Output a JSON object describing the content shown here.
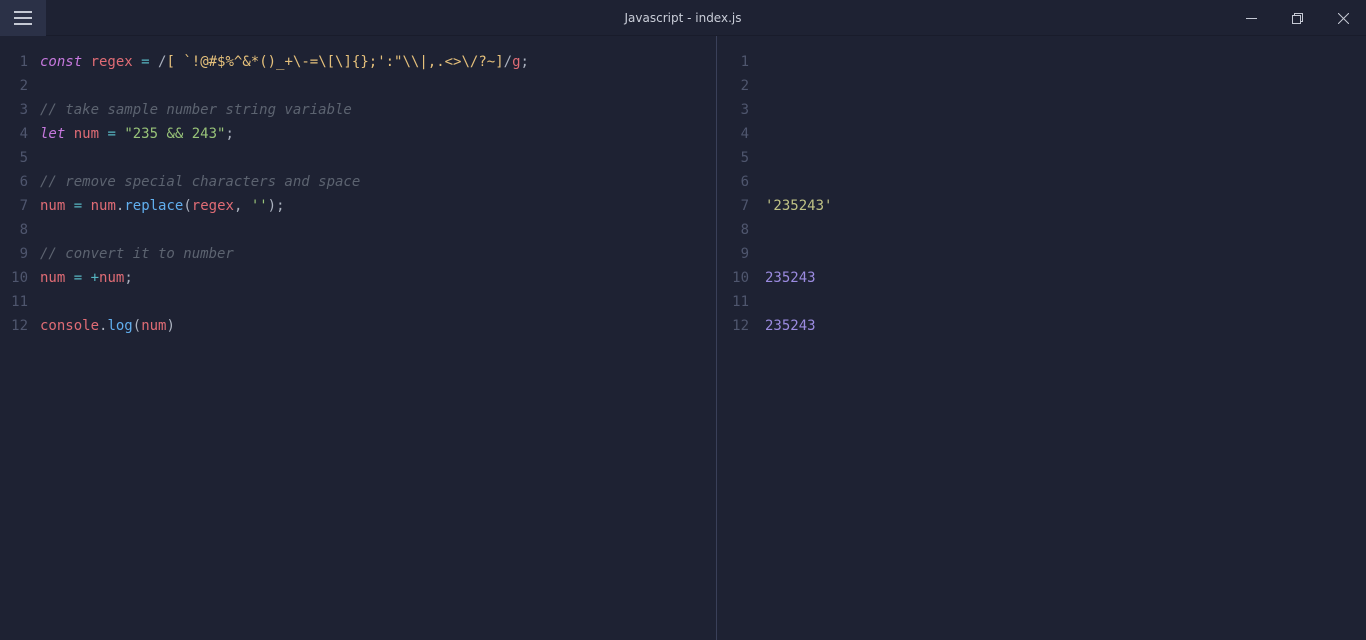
{
  "titlebar": {
    "title": "Javascript - index.js"
  },
  "editor": {
    "left": {
      "lines": [
        {
          "n": "1",
          "tokens": [
            {
              "t": "const ",
              "c": "kw"
            },
            {
              "t": "regex",
              "c": "ident"
            },
            {
              "t": " ",
              "c": "plain"
            },
            {
              "t": "=",
              "c": "op"
            },
            {
              "t": " ",
              "c": "plain"
            },
            {
              "t": "/",
              "c": "regex-delim"
            },
            {
              "t": "[ `!@#$%^&*()_+\\-=\\[\\]{};':\"\\\\|,.<>\\/?~]",
              "c": "regex-body"
            },
            {
              "t": "/",
              "c": "regex-delim"
            },
            {
              "t": "g",
              "c": "ident"
            },
            {
              "t": ";",
              "c": "plain"
            }
          ]
        },
        {
          "n": "2",
          "tokens": []
        },
        {
          "n": "3",
          "tokens": [
            {
              "t": "// take sample number string variable",
              "c": "comment"
            }
          ]
        },
        {
          "n": "4",
          "tokens": [
            {
              "t": "let ",
              "c": "kw"
            },
            {
              "t": "num",
              "c": "ident"
            },
            {
              "t": " ",
              "c": "plain"
            },
            {
              "t": "=",
              "c": "op"
            },
            {
              "t": " ",
              "c": "plain"
            },
            {
              "t": "\"235 && 243\"",
              "c": "str"
            },
            {
              "t": ";",
              "c": "plain"
            }
          ]
        },
        {
          "n": "5",
          "tokens": []
        },
        {
          "n": "6",
          "tokens": [
            {
              "t": "// remove special characters and space",
              "c": "comment"
            }
          ]
        },
        {
          "n": "7",
          "tokens": [
            {
              "t": "num",
              "c": "ident"
            },
            {
              "t": " ",
              "c": "plain"
            },
            {
              "t": "=",
              "c": "op"
            },
            {
              "t": " ",
              "c": "plain"
            },
            {
              "t": "num",
              "c": "ident"
            },
            {
              "t": ".",
              "c": "plain"
            },
            {
              "t": "replace",
              "c": "method"
            },
            {
              "t": "(",
              "c": "plain"
            },
            {
              "t": "regex",
              "c": "ident"
            },
            {
              "t": ", ",
              "c": "plain"
            },
            {
              "t": "''",
              "c": "str"
            },
            {
              "t": ");",
              "c": "plain"
            }
          ]
        },
        {
          "n": "8",
          "tokens": []
        },
        {
          "n": "9",
          "tokens": [
            {
              "t": "// convert it to number",
              "c": "comment"
            }
          ]
        },
        {
          "n": "10",
          "tokens": [
            {
              "t": "num",
              "c": "ident"
            },
            {
              "t": " ",
              "c": "plain"
            },
            {
              "t": "=",
              "c": "op"
            },
            {
              "t": " ",
              "c": "plain"
            },
            {
              "t": "+",
              "c": "op"
            },
            {
              "t": "num",
              "c": "ident"
            },
            {
              "t": ";",
              "c": "plain"
            }
          ]
        },
        {
          "n": "11",
          "tokens": []
        },
        {
          "n": "12",
          "tokens": [
            {
              "t": "console",
              "c": "ident"
            },
            {
              "t": ".",
              "c": "plain"
            },
            {
              "t": "log",
              "c": "method"
            },
            {
              "t": "(",
              "c": "plain"
            },
            {
              "t": "num",
              "c": "ident"
            },
            {
              "t": ")",
              "c": "plain"
            }
          ]
        }
      ]
    },
    "right": {
      "lines": [
        {
          "n": "1",
          "tokens": []
        },
        {
          "n": "2",
          "tokens": []
        },
        {
          "n": "3",
          "tokens": []
        },
        {
          "n": "4",
          "tokens": []
        },
        {
          "n": "5",
          "tokens": []
        },
        {
          "n": "6",
          "tokens": []
        },
        {
          "n": "7",
          "tokens": [
            {
              "t": "'235243'",
              "c": "out-str"
            }
          ]
        },
        {
          "n": "8",
          "tokens": []
        },
        {
          "n": "9",
          "tokens": []
        },
        {
          "n": "10",
          "tokens": [
            {
              "t": "235243",
              "c": "out-num"
            }
          ]
        },
        {
          "n": "11",
          "tokens": []
        },
        {
          "n": "12",
          "tokens": [
            {
              "t": "235243",
              "c": "out-num"
            }
          ]
        }
      ]
    }
  }
}
